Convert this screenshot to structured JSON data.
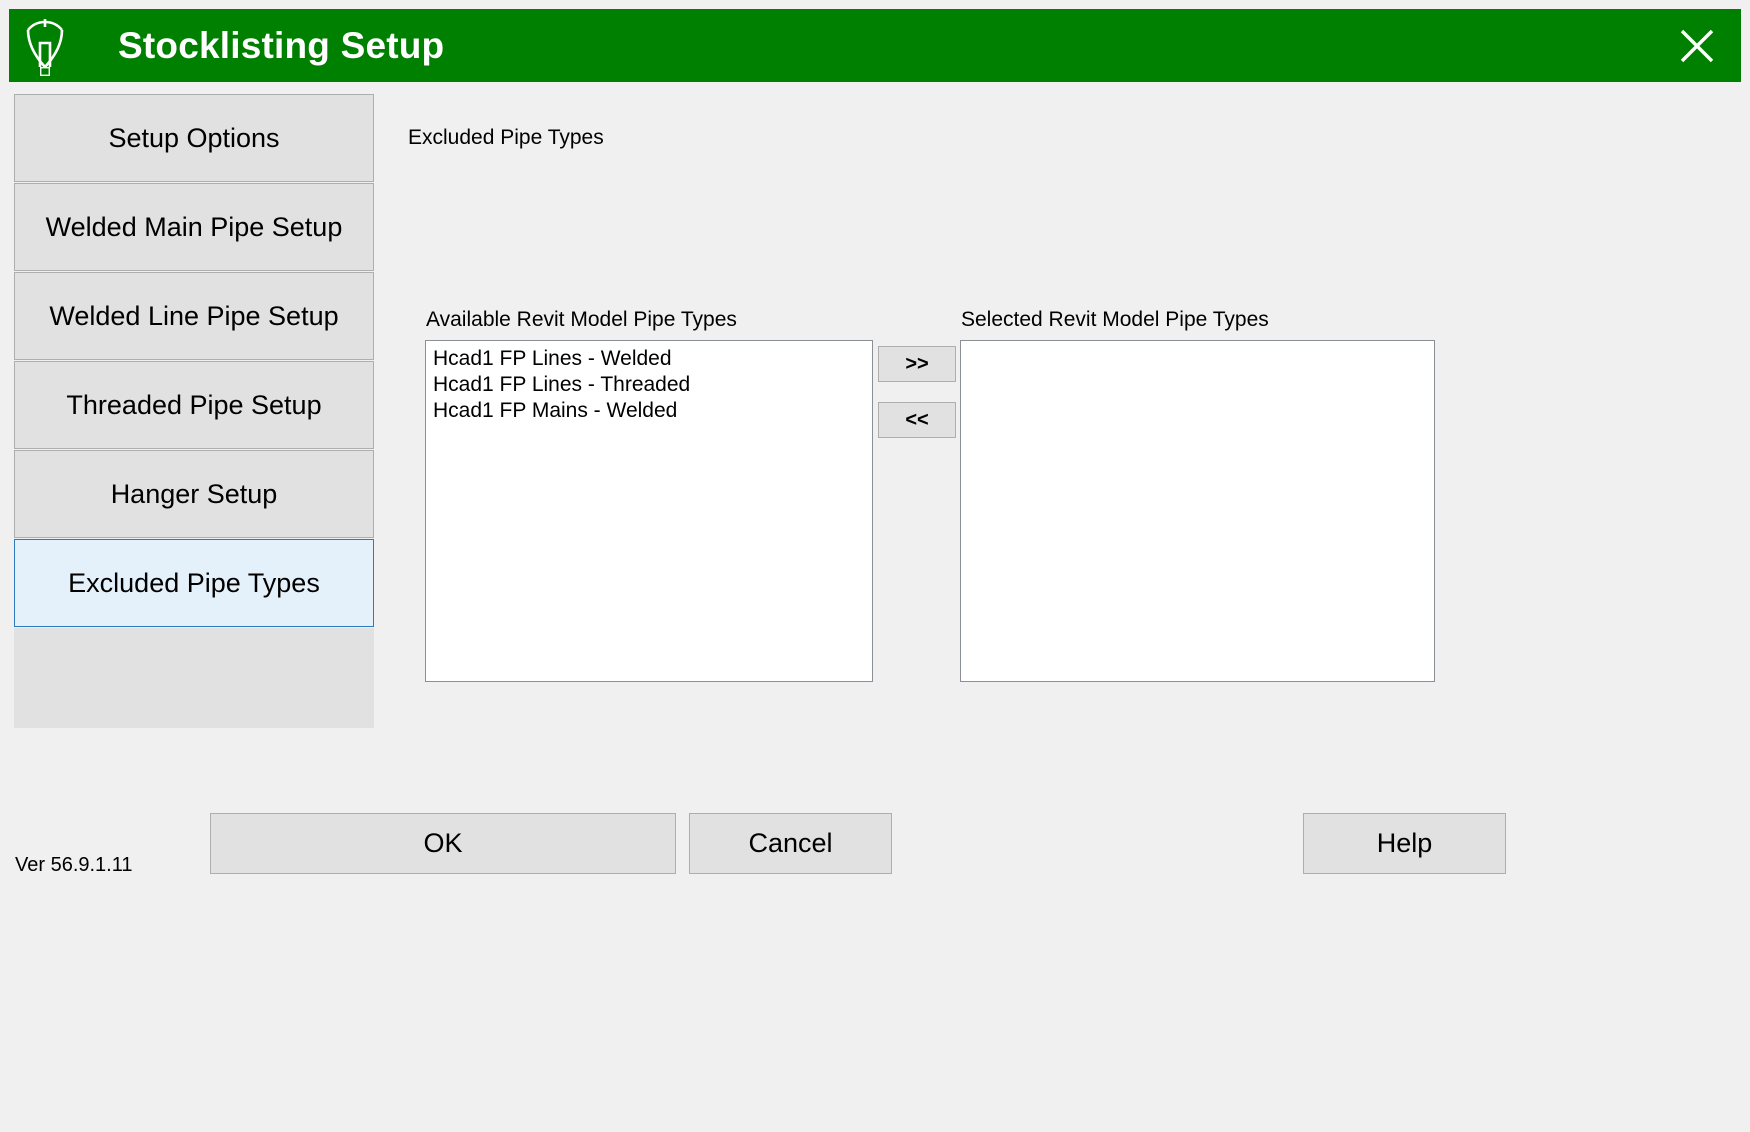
{
  "window": {
    "title": "Stocklisting Setup",
    "logo_icon": "sprinkler-head-logo-icon",
    "close_icon": "close-icon",
    "title_bar_color": "#008000",
    "title_text_color": "#ffffff"
  },
  "sidebar": {
    "items": [
      {
        "label": "Setup Options",
        "active": false
      },
      {
        "label": "Welded Main Pipe Setup",
        "active": false
      },
      {
        "label": "Welded Line Pipe Setup",
        "active": false
      },
      {
        "label": "Threaded Pipe Setup",
        "active": false
      },
      {
        "label": "Hanger Setup",
        "active": false
      },
      {
        "label": "Excluded Pipe Types",
        "active": true
      }
    ],
    "active_bg": "#e4f1fb",
    "active_border": "#2b7bbd",
    "button_bg": "#e1e1e1"
  },
  "main": {
    "heading": "Excluded Pipe Types",
    "available": {
      "label": "Available Revit Model Pipe Types",
      "items": [
        "Hcad1 FP Lines - Welded",
        "Hcad1 FP Lines - Threaded",
        "Hcad1 FP Mains - Welded"
      ]
    },
    "selected": {
      "label": "Selected Revit Model Pipe Types",
      "items": []
    },
    "transfer": {
      "move_right_label": ">>",
      "move_left_label": "<<"
    }
  },
  "footer": {
    "version": "Ver 56.9.1.11",
    "ok_label": "OK",
    "cancel_label": "Cancel",
    "help_label": "Help"
  }
}
